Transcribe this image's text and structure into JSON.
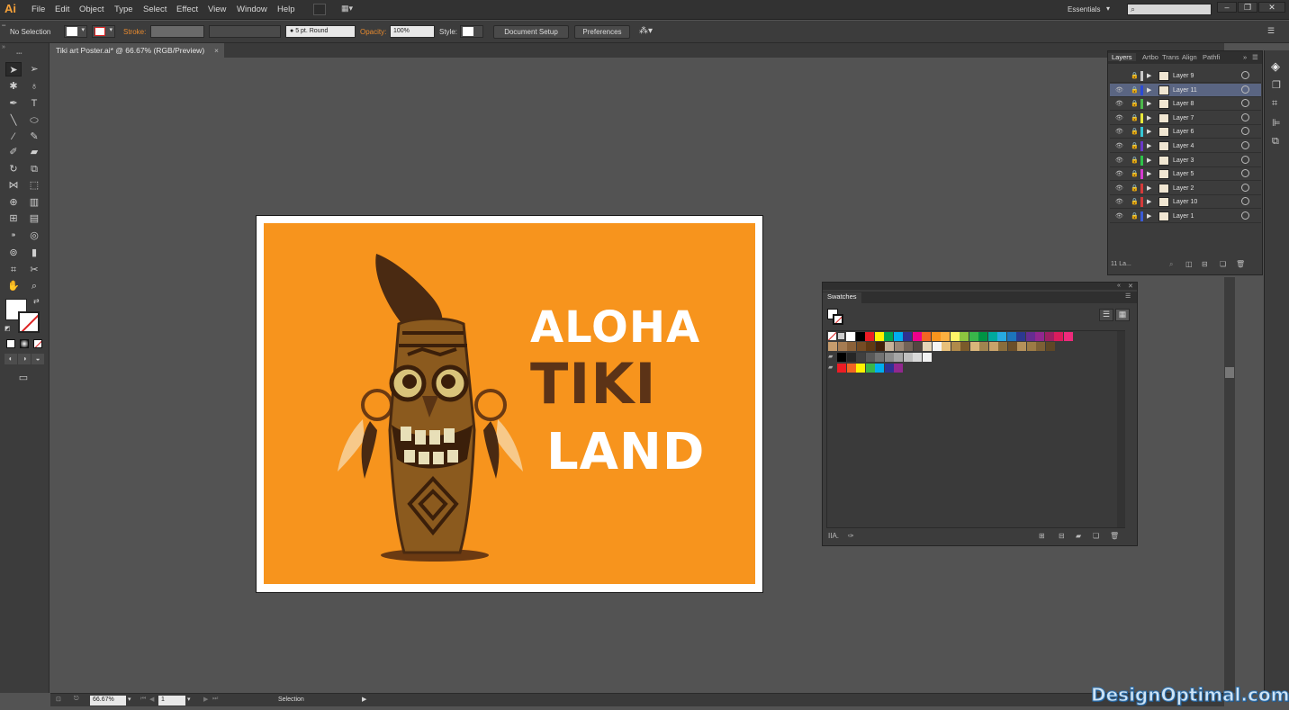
{
  "app": {
    "logo": "Ai",
    "menu": [
      "File",
      "Edit",
      "Object",
      "Type",
      "Select",
      "Effect",
      "View",
      "Window",
      "Help"
    ],
    "workspace": "Essentials",
    "search_placeholder": ""
  },
  "control_bar": {
    "selection_status": "No Selection",
    "stroke_label": "Stroke:",
    "brush_label": "5 pt. Round",
    "opacity_label": "Opacity:",
    "opacity_value": "100%",
    "style_label": "Style:",
    "document_setup": "Document Setup",
    "preferences": "Preferences"
  },
  "document": {
    "tab_title": "Tiki art Poster.ai* @ 66.67% (RGB/Preview)",
    "close": "×"
  },
  "artwork": {
    "line1": "ALOHA",
    "line2": "TIKI",
    "line3": "LAND",
    "colors": {
      "background": "#f7941d",
      "light_text": "#ffffff",
      "dark_text": "#5c3317",
      "wood": "#8b5a1e",
      "dark_wood": "#4a2a10",
      "feather": "#4a2a12",
      "ear_feather": "#f7c98a"
    }
  },
  "layers_panel": {
    "tabs": [
      "Layers",
      "Artbo",
      "Trans",
      "Align",
      "Pathfi"
    ],
    "layers": [
      {
        "name": "Layer 9",
        "color": "#c8c8c8",
        "visible": false,
        "selected": false
      },
      {
        "name": "Layer 11",
        "color": "#2b4bd6",
        "visible": true,
        "selected": true
      },
      {
        "name": "Layer 8",
        "color": "#4bb84b",
        "visible": true,
        "selected": false
      },
      {
        "name": "Layer 7",
        "color": "#e8e83a",
        "visible": true,
        "selected": false
      },
      {
        "name": "Layer 6",
        "color": "#35c7d6",
        "visible": true,
        "selected": false
      },
      {
        "name": "Layer 4",
        "color": "#6a38c9",
        "visible": true,
        "selected": false
      },
      {
        "name": "Layer 3",
        "color": "#2ec24a",
        "visible": true,
        "selected": false
      },
      {
        "name": "Layer 5",
        "color": "#d63ad0",
        "visible": true,
        "selected": false
      },
      {
        "name": "Layer 2",
        "color": "#d63a3a",
        "visible": true,
        "selected": false
      },
      {
        "name": "Layer 10",
        "color": "#d63a3a",
        "visible": true,
        "selected": false
      },
      {
        "name": "Layer 1",
        "color": "#3a5ad6",
        "visible": true,
        "selected": false
      }
    ],
    "footer": "11 La..."
  },
  "swatches_panel": {
    "title": "Swatches",
    "row1": [
      "#ffffff",
      "#000000",
      "#ed1c24",
      "#fff200",
      "#00a651",
      "#00aeef",
      "#2e3192",
      "#ec008c",
      "#f26522",
      "#f7941d",
      "#fcb040",
      "#fff568",
      "#8dc63f",
      "#39b54a",
      "#009444",
      "#00a99d",
      "#27aae1",
      "#1c75bc",
      "#2b3990",
      "#662d91",
      "#92278f",
      "#9e1f63",
      "#da1c5c",
      "#ee2a7b"
    ],
    "row2": [
      "#c69c6d",
      "#a67c52",
      "#8c6239",
      "#754c24",
      "#603913",
      "#42210b",
      "#c7b299",
      "#998675",
      "#736357",
      "#534741",
      "#e6d5b8",
      "#f5f5f5",
      "#e8c07a",
      "#b08a4a",
      "#7a5a2a",
      "#d9b57a",
      "#a0844f",
      "#c9a36a",
      "#8a6d3b",
      "#6b4f2a",
      "#b5915a",
      "#9c7b45",
      "#7d6035",
      "#5e4726"
    ],
    "row3": [
      "#000000",
      "#262626",
      "#404040",
      "#595959",
      "#737373",
      "#8c8c8c",
      "#a6a6a6",
      "#bfbfbf",
      "#d9d9d9",
      "#f2f2f2"
    ],
    "row4": [
      "#ed1c24",
      "#f26522",
      "#fff200",
      "#39b54a",
      "#00aeef",
      "#2e3192",
      "#92278f"
    ]
  },
  "status_bar": {
    "zoom": "66.67%",
    "page": "1",
    "tool_status": "Selection"
  },
  "watermark": "DesignOptimal.com"
}
